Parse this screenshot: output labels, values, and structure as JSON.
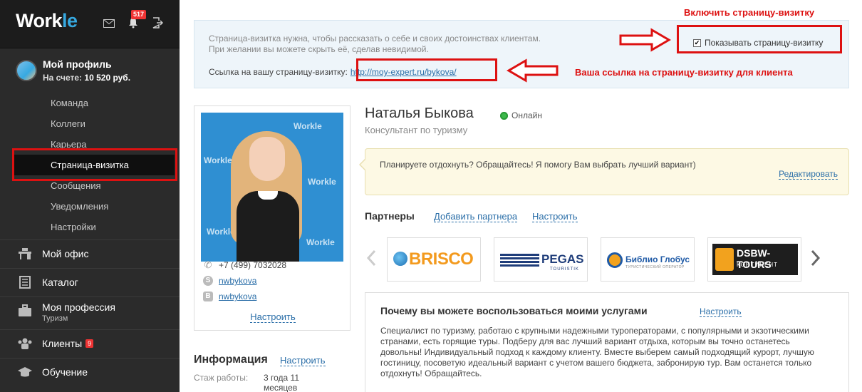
{
  "sidebar": {
    "logo_main": "Work",
    "logo_accent": "le",
    "notifications_count": "517",
    "profile": {
      "name": "Мой профиль",
      "balance_label": "На счете:",
      "balance_value": "10 520 руб."
    },
    "subnav": [
      {
        "label": "Команда"
      },
      {
        "label": "Коллеги"
      },
      {
        "label": "Карьера"
      },
      {
        "label": "Страница-визитка",
        "active": true
      },
      {
        "label": "Сообщения"
      },
      {
        "label": "Уведомления"
      },
      {
        "label": "Настройки"
      }
    ],
    "mainnav": [
      {
        "label": "Мой офис",
        "icon": "desk-icon"
      },
      {
        "label": "Каталог",
        "icon": "catalog-icon"
      },
      {
        "label": "Моя профессия",
        "sub": "Туризм",
        "icon": "briefcase-icon"
      },
      {
        "label": "Клиенты",
        "badge": "9",
        "icon": "people-icon"
      },
      {
        "label": "Обучение",
        "icon": "graduation-cap-icon"
      }
    ]
  },
  "infobox": {
    "line1": "Страница-визитка нужна, чтобы рассказать о себе и своих достоинствах клиентам.",
    "line2": "При желании вы можете скрыть её, сделав невидимой.",
    "link_label": "Ссылка на вашу страницу-визитку:",
    "link_url": "http://moy-expert.ru/bykova/",
    "show_card_label": "Показывать страницу-визитку",
    "show_card_checked": true
  },
  "annotations": {
    "enable_card": "Включить страницу-визитку",
    "your_link": "Ваша ссылка на страницу-визитку для клиента",
    "color": "#dd1111"
  },
  "profile_card": {
    "photo_brand": "Workle",
    "phone": "+7 (499) 7032028",
    "skype": "nwbykova",
    "vk": "nwbykova",
    "setup": "Настроить"
  },
  "info": {
    "title": "Информация",
    "setup": "Настроить",
    "experience_label": "Стаж работы:",
    "experience_value": "3 года 11 месяцев"
  },
  "user": {
    "name": "Наталья Быкова",
    "status": "Онлайн",
    "title": "Консультант по туризму"
  },
  "speech": {
    "text": "Планируете отдохнуть? Обращайтесь! Я помогу Вам выбрать лучший вариант)",
    "edit": "Редактировать"
  },
  "partners": {
    "title": "Партнеры",
    "add": "Добавить партнера",
    "setup": "Настроить",
    "logos": [
      {
        "name": "BRISCO"
      },
      {
        "name": "PEGAS",
        "sub": "TOURISTIK"
      },
      {
        "name": "Библио Глобус",
        "sub": "ТУРИСТИЧЕСКИЙ ОПЕРАТОР"
      },
      {
        "name": "DSBW-TOURS",
        "sub": "КОНТИНЕНТ"
      }
    ]
  },
  "why": {
    "title": "Почему вы можете воспользоваться моими услугами",
    "setup": "Настроить",
    "text": "Специалист по туризму, работаю с крупными надежными туроператорами, с популярными и экзотическими странами, есть горящие туры. Подберу для вас лучший вариант отдыха, которым вы точно останетесь довольны! Индивидуальный подход к каждому клиенту. Вместе выберем самый подходящий курорт, лучшую гостиницу, посоветую идеальный вариант с учетом вашего бюджета, забронирую тур. Вам останется только отдохнуть! Обращайтесь."
  },
  "colors": {
    "sidebar_bg": "#2b2b2b",
    "link": "#2a6ea8",
    "online": "#3cb94b",
    "badge": "#ee3333"
  }
}
